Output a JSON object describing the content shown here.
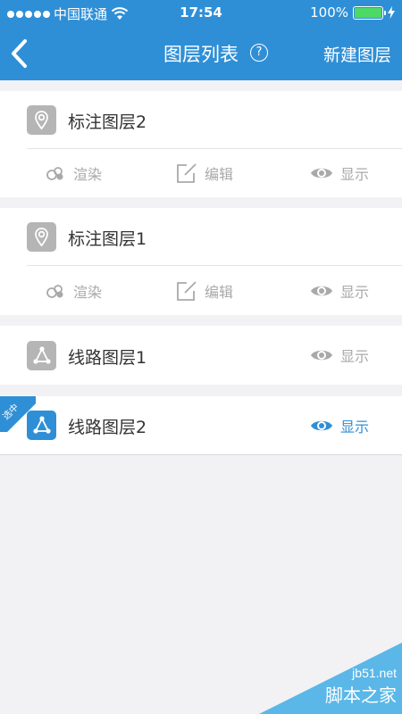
{
  "status_bar": {
    "carrier": "中国联通",
    "time": "17:54",
    "battery": "100%",
    "signal_icon": "signal-dots-icon",
    "wifi_icon": "wifi-icon",
    "battery_icon": "battery-icon",
    "charging_icon": "charging-bolt-icon"
  },
  "nav": {
    "title": "图层列表",
    "help": "?",
    "new_layer": "新建图层",
    "back_icon": "back-chevron-icon"
  },
  "layers": [
    {
      "name": "标注图层2",
      "icon": "pin-icon",
      "actions": {
        "render": "渲染",
        "edit": "编辑",
        "show": "显示"
      }
    },
    {
      "name": "标注图层1",
      "icon": "pin-icon",
      "actions": {
        "render": "渲染",
        "edit": "编辑",
        "show": "显示"
      }
    },
    {
      "name": "线路图层1",
      "icon": "route-icon",
      "actions": {
        "show": "显示"
      }
    },
    {
      "name": "线路图层2",
      "icon": "route-icon",
      "badge": "选中",
      "actions": {
        "show": "显示"
      }
    }
  ],
  "colors": {
    "primary": "#2f8fd6",
    "inactive": "#a9a9a9",
    "background": "#f2f2f4"
  },
  "watermark": {
    "site": "jb51.net",
    "brand": "脚本之家"
  }
}
